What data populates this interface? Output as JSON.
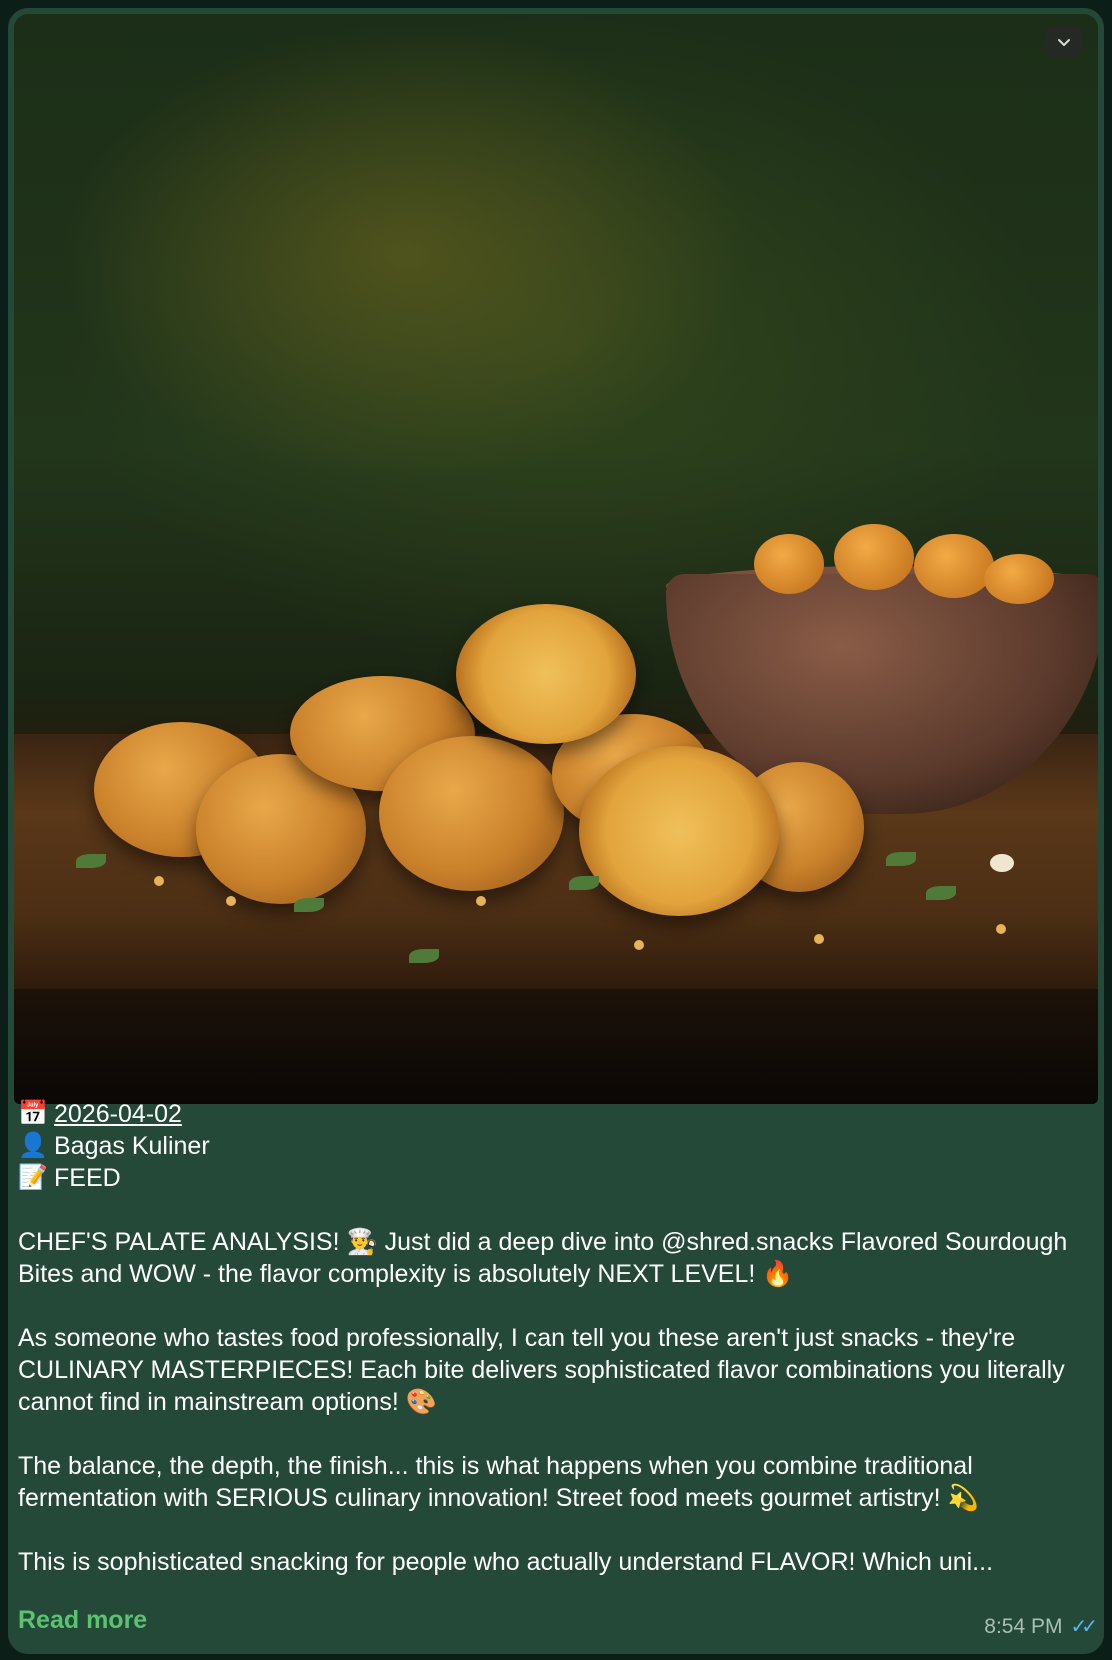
{
  "message": {
    "date": "2026-04-02",
    "author": "Bagas Kuliner",
    "category": "FEED",
    "icons": {
      "date": "calendar-icon",
      "author": "person-icon",
      "category": "memo-icon"
    },
    "paragraphs": [
      "CHEF'S PALATE ANALYSIS! 👨‍🍳 Just did a deep dive into @shred.snacks Flavored Sourdough Bites and WOW - the flavor complexity is absolutely NEXT LEVEL! 🔥",
      "As someone who tastes food professionally, I can tell you these aren't just snacks - they're CULINARY MASTERPIECES! Each bite delivers sophisticated flavor combinations you literally cannot find in mainstream options! 🎨",
      "The balance, the depth, the finish... this is what happens when you combine traditional fermentation with SERIOUS culinary innovation! Street food meets gourmet artistry! 💫",
      "This is sophisticated snacking for people who actually understand FLAVOR! Which uni..."
    ],
    "read_more": "Read more",
    "time": "8:54 PM",
    "status": "read",
    "ticks": "✓✓"
  },
  "colors": {
    "bubble": "#244938",
    "link": "#5bc36f",
    "ticks": "#59b7f0"
  }
}
